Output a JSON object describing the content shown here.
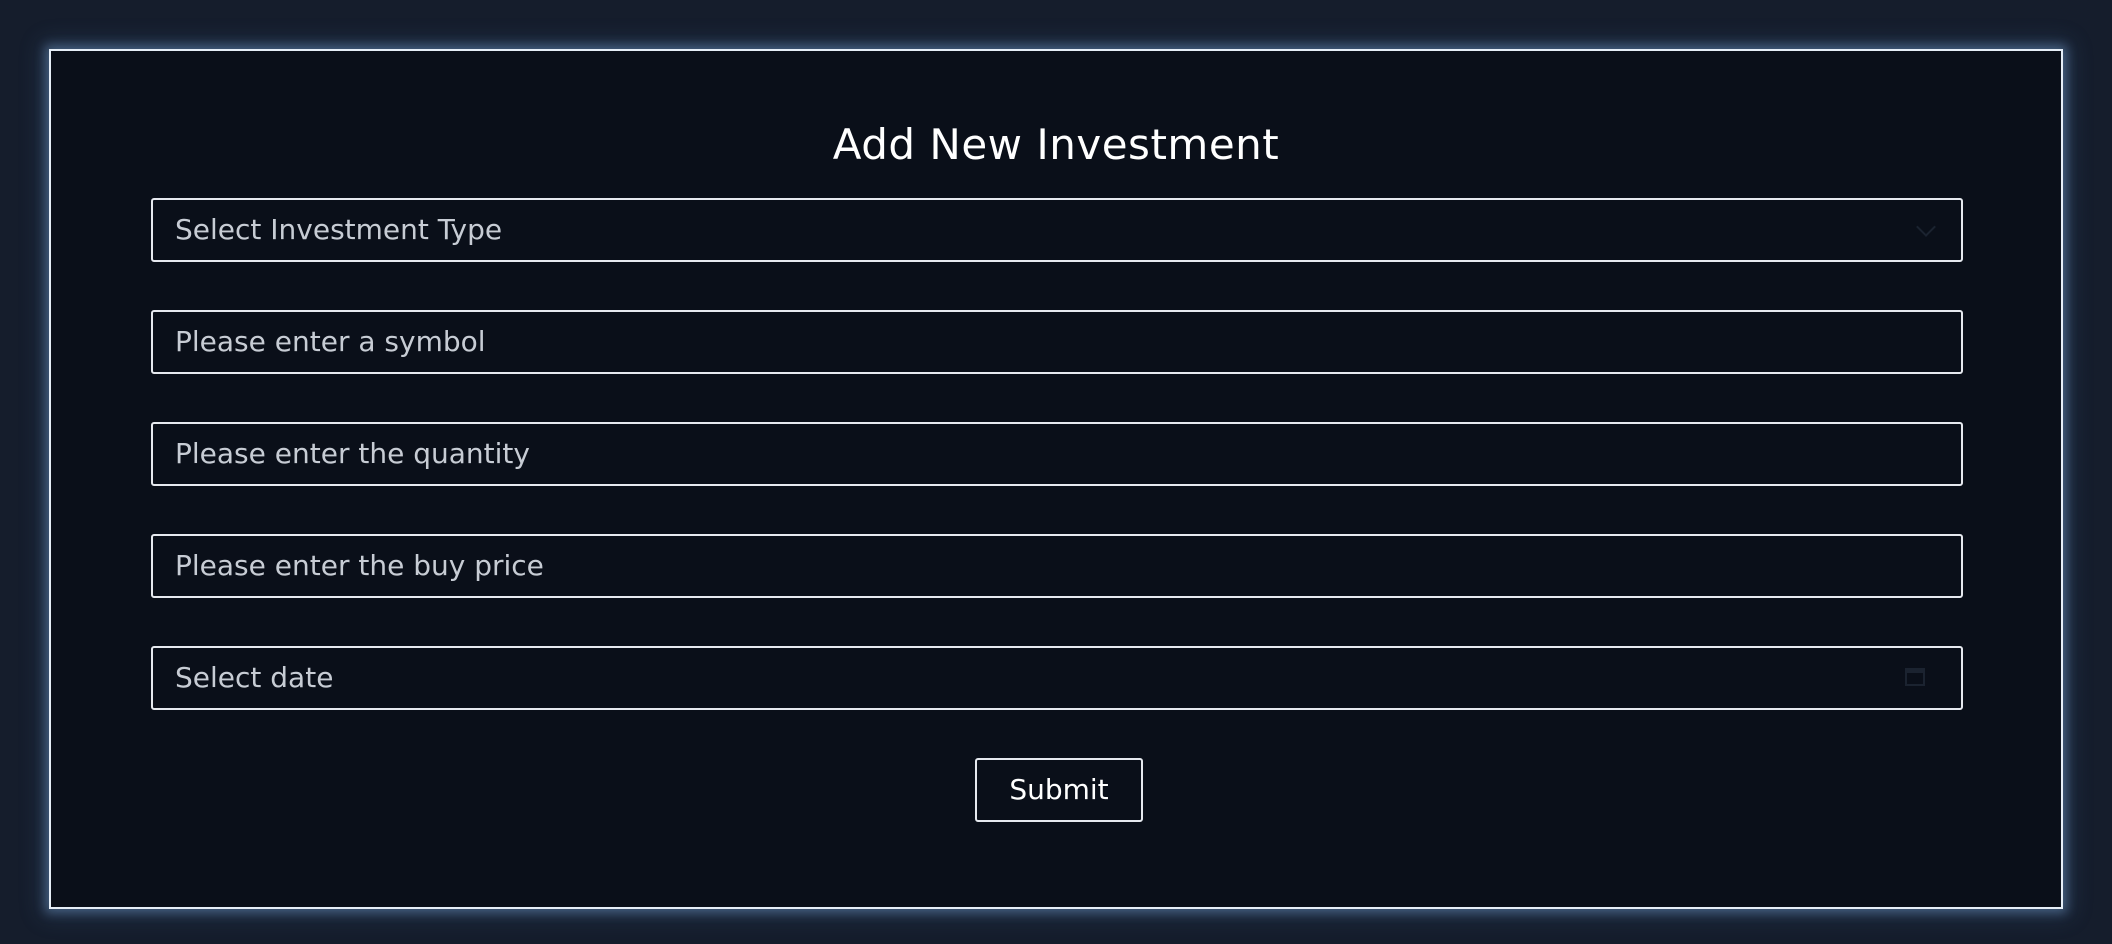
{
  "form": {
    "title": "Add New Investment",
    "investment_type": {
      "placeholder": "Select Investment Type",
      "icon": "chevron-down-icon"
    },
    "symbol": {
      "placeholder": "Please enter a symbol"
    },
    "quantity": {
      "placeholder": "Please enter the quantity"
    },
    "buy_price": {
      "placeholder": "Please enter the buy price"
    },
    "date": {
      "placeholder": "Select date",
      "icon": "calendar-icon"
    },
    "submit_label": "Submit"
  },
  "colors": {
    "page_background": "#151d2c",
    "panel_background": "#0a0f19",
    "border": "#e6e9ef",
    "placeholder_text": "#c7ccd4",
    "title_text": "#ffffff"
  }
}
